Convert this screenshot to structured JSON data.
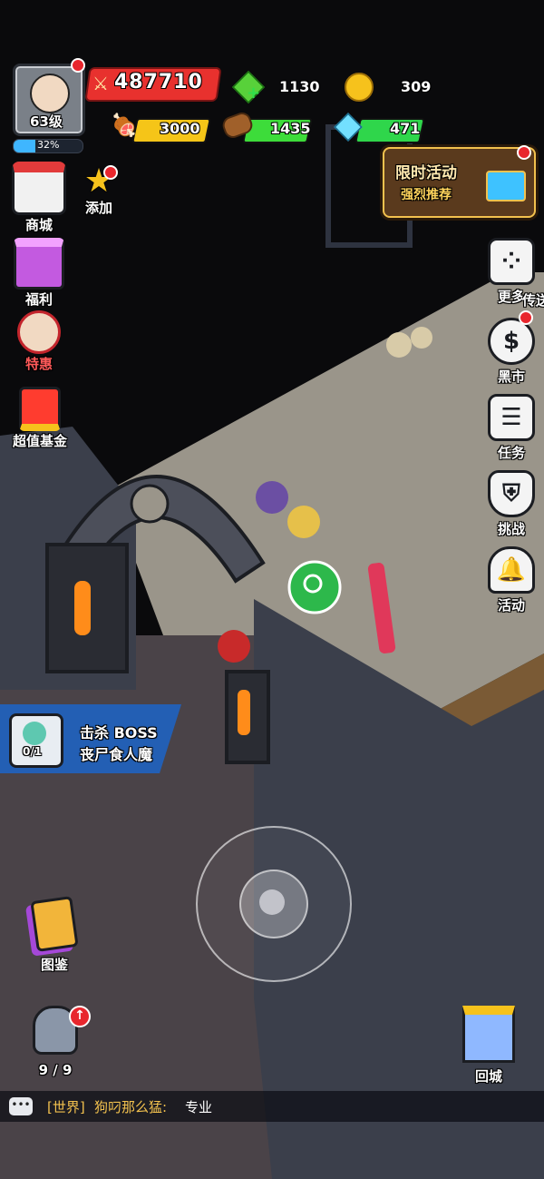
{
  "player": {
    "level": "63级",
    "xp_percent_label": "32%",
    "xp_fraction": 0.32,
    "combat_power": "487710"
  },
  "resources": {
    "gems": "1130",
    "gold": "309",
    "meat": "3000",
    "wood": "1435",
    "crystal": "471"
  },
  "left_menu": {
    "shop": "商城",
    "add": "添加",
    "welfare": "福利",
    "special": "特惠",
    "fund": "超值基金"
  },
  "event": {
    "title": "限时活动",
    "subtitle": "强烈推荐"
  },
  "right_menu": {
    "more": "更多",
    "teleport": "传送",
    "black_market": "黑市",
    "task": "任务",
    "challenge": "挑战",
    "activity": "活动"
  },
  "quest": {
    "title": "击杀 BOSS",
    "target": "丧尸食人魔",
    "progress": "0/1"
  },
  "bottom": {
    "codex": "图鉴",
    "helmet_count": "9 / 9",
    "return_city": "回城"
  },
  "chat": {
    "channel": "[世界]",
    "sender": "狗叼那么猛:",
    "message": "专业"
  },
  "colors": {
    "power_bar": "#e8312e",
    "meat_bar": "#f5c518",
    "wood_bar": "#3ddc3a",
    "crystal_bar": "#2fd64b",
    "quest_panel": "#1c64c8",
    "channel_color": "#f2c14e"
  }
}
